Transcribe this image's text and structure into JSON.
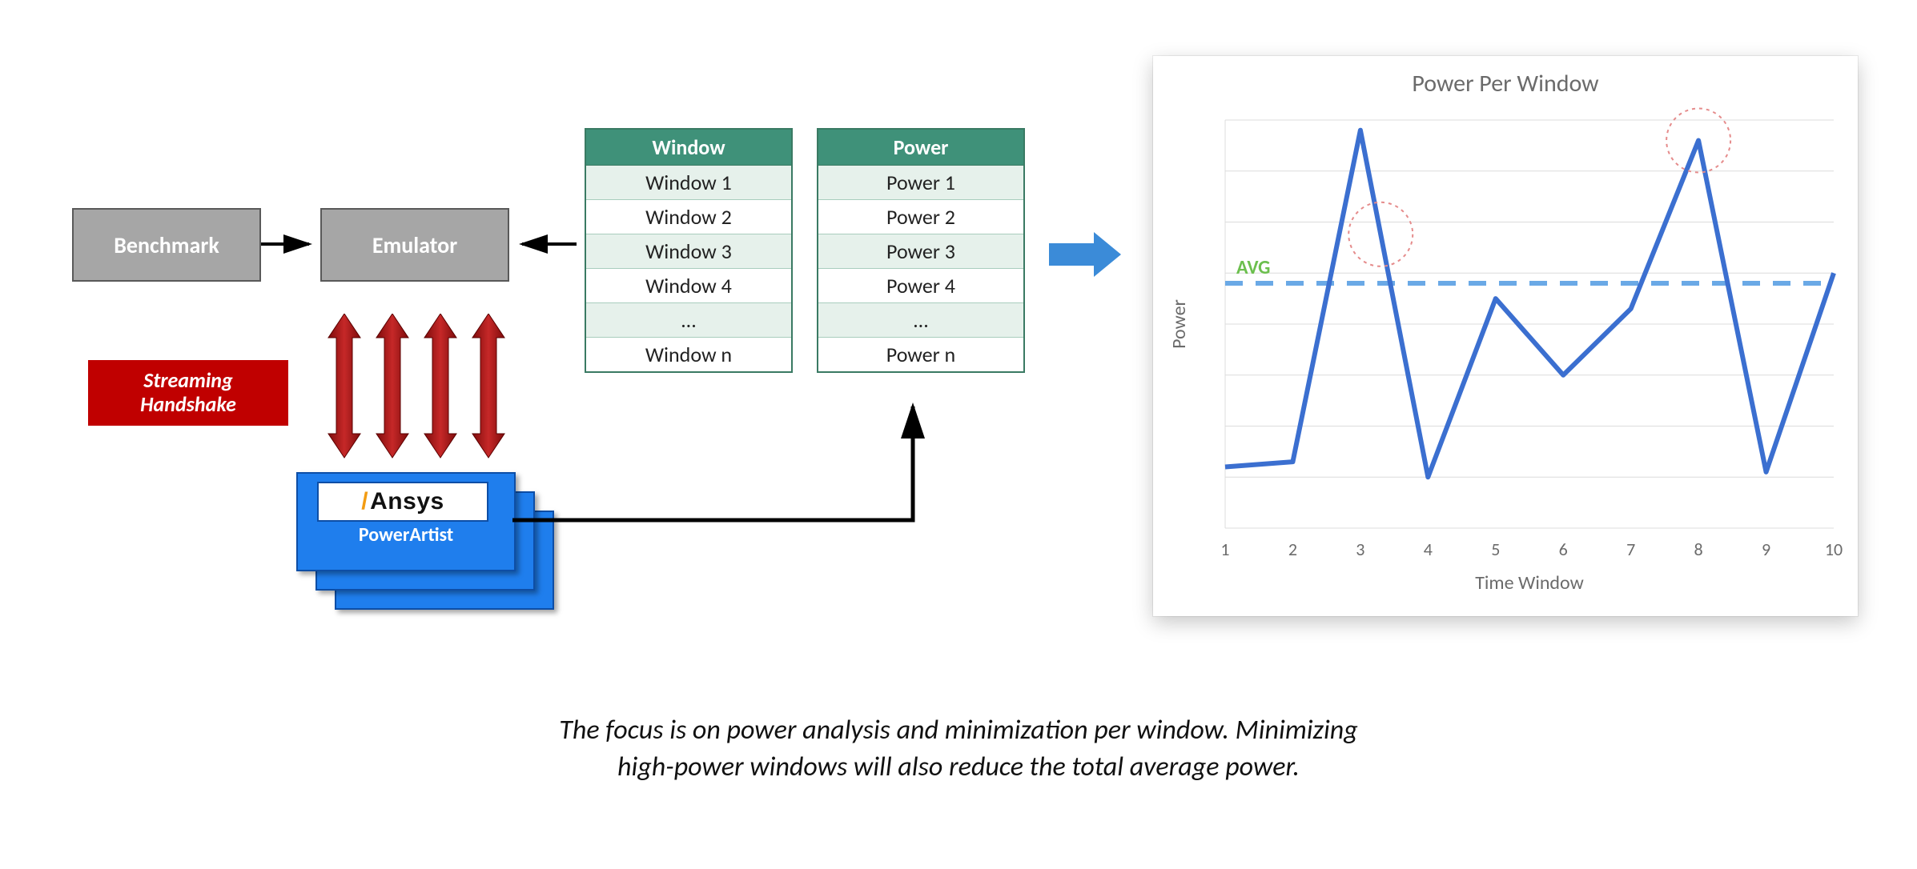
{
  "blocks": {
    "benchmark": "Benchmark",
    "emulator": "Emulator",
    "streaming": "Streaming\nHandshake",
    "ansys_brand": "Ansys",
    "powerartist": "PowerArtist"
  },
  "tables": {
    "window": {
      "header": "Window",
      "rows": [
        "Window 1",
        "Window 2",
        "Window 3",
        "Window 4",
        "…",
        "Window n"
      ]
    },
    "power": {
      "header": "Power",
      "rows": [
        "Power 1",
        "Power 2",
        "Power 3",
        "Power 4",
        "…",
        "Power n"
      ]
    }
  },
  "chart_data": {
    "type": "line",
    "title": "Power Per Window",
    "xlabel": "Time Window",
    "ylabel": "Power",
    "x": [
      1,
      2,
      3,
      4,
      5,
      6,
      7,
      8,
      9,
      10
    ],
    "y": [
      1.2,
      1.3,
      7.8,
      1.0,
      4.5,
      3.0,
      4.3,
      7.6,
      1.1,
      5.0
    ],
    "ylim": [
      0,
      8
    ],
    "xlim": [
      1,
      10
    ],
    "avg_label": "AVG",
    "avg_value": 4.8,
    "peak_markers_x": [
      3.3,
      8.0
    ],
    "x_ticks": [
      1,
      2,
      3,
      4,
      5,
      6,
      7,
      8,
      9,
      10
    ],
    "grid": true
  },
  "caption": {
    "line1": "The focus is on power analysis and minimization per window. Minimizing",
    "line2": "high-power windows will also reduce the total average power."
  },
  "colors": {
    "chart_line": "#3b6fd0",
    "avg_dash": "#6aa9e6",
    "avg_text": "#6cbf4e",
    "peak_ring": "#e58b8b",
    "grid": "#dcdcdc",
    "axis_text": "#6b6b6b"
  }
}
